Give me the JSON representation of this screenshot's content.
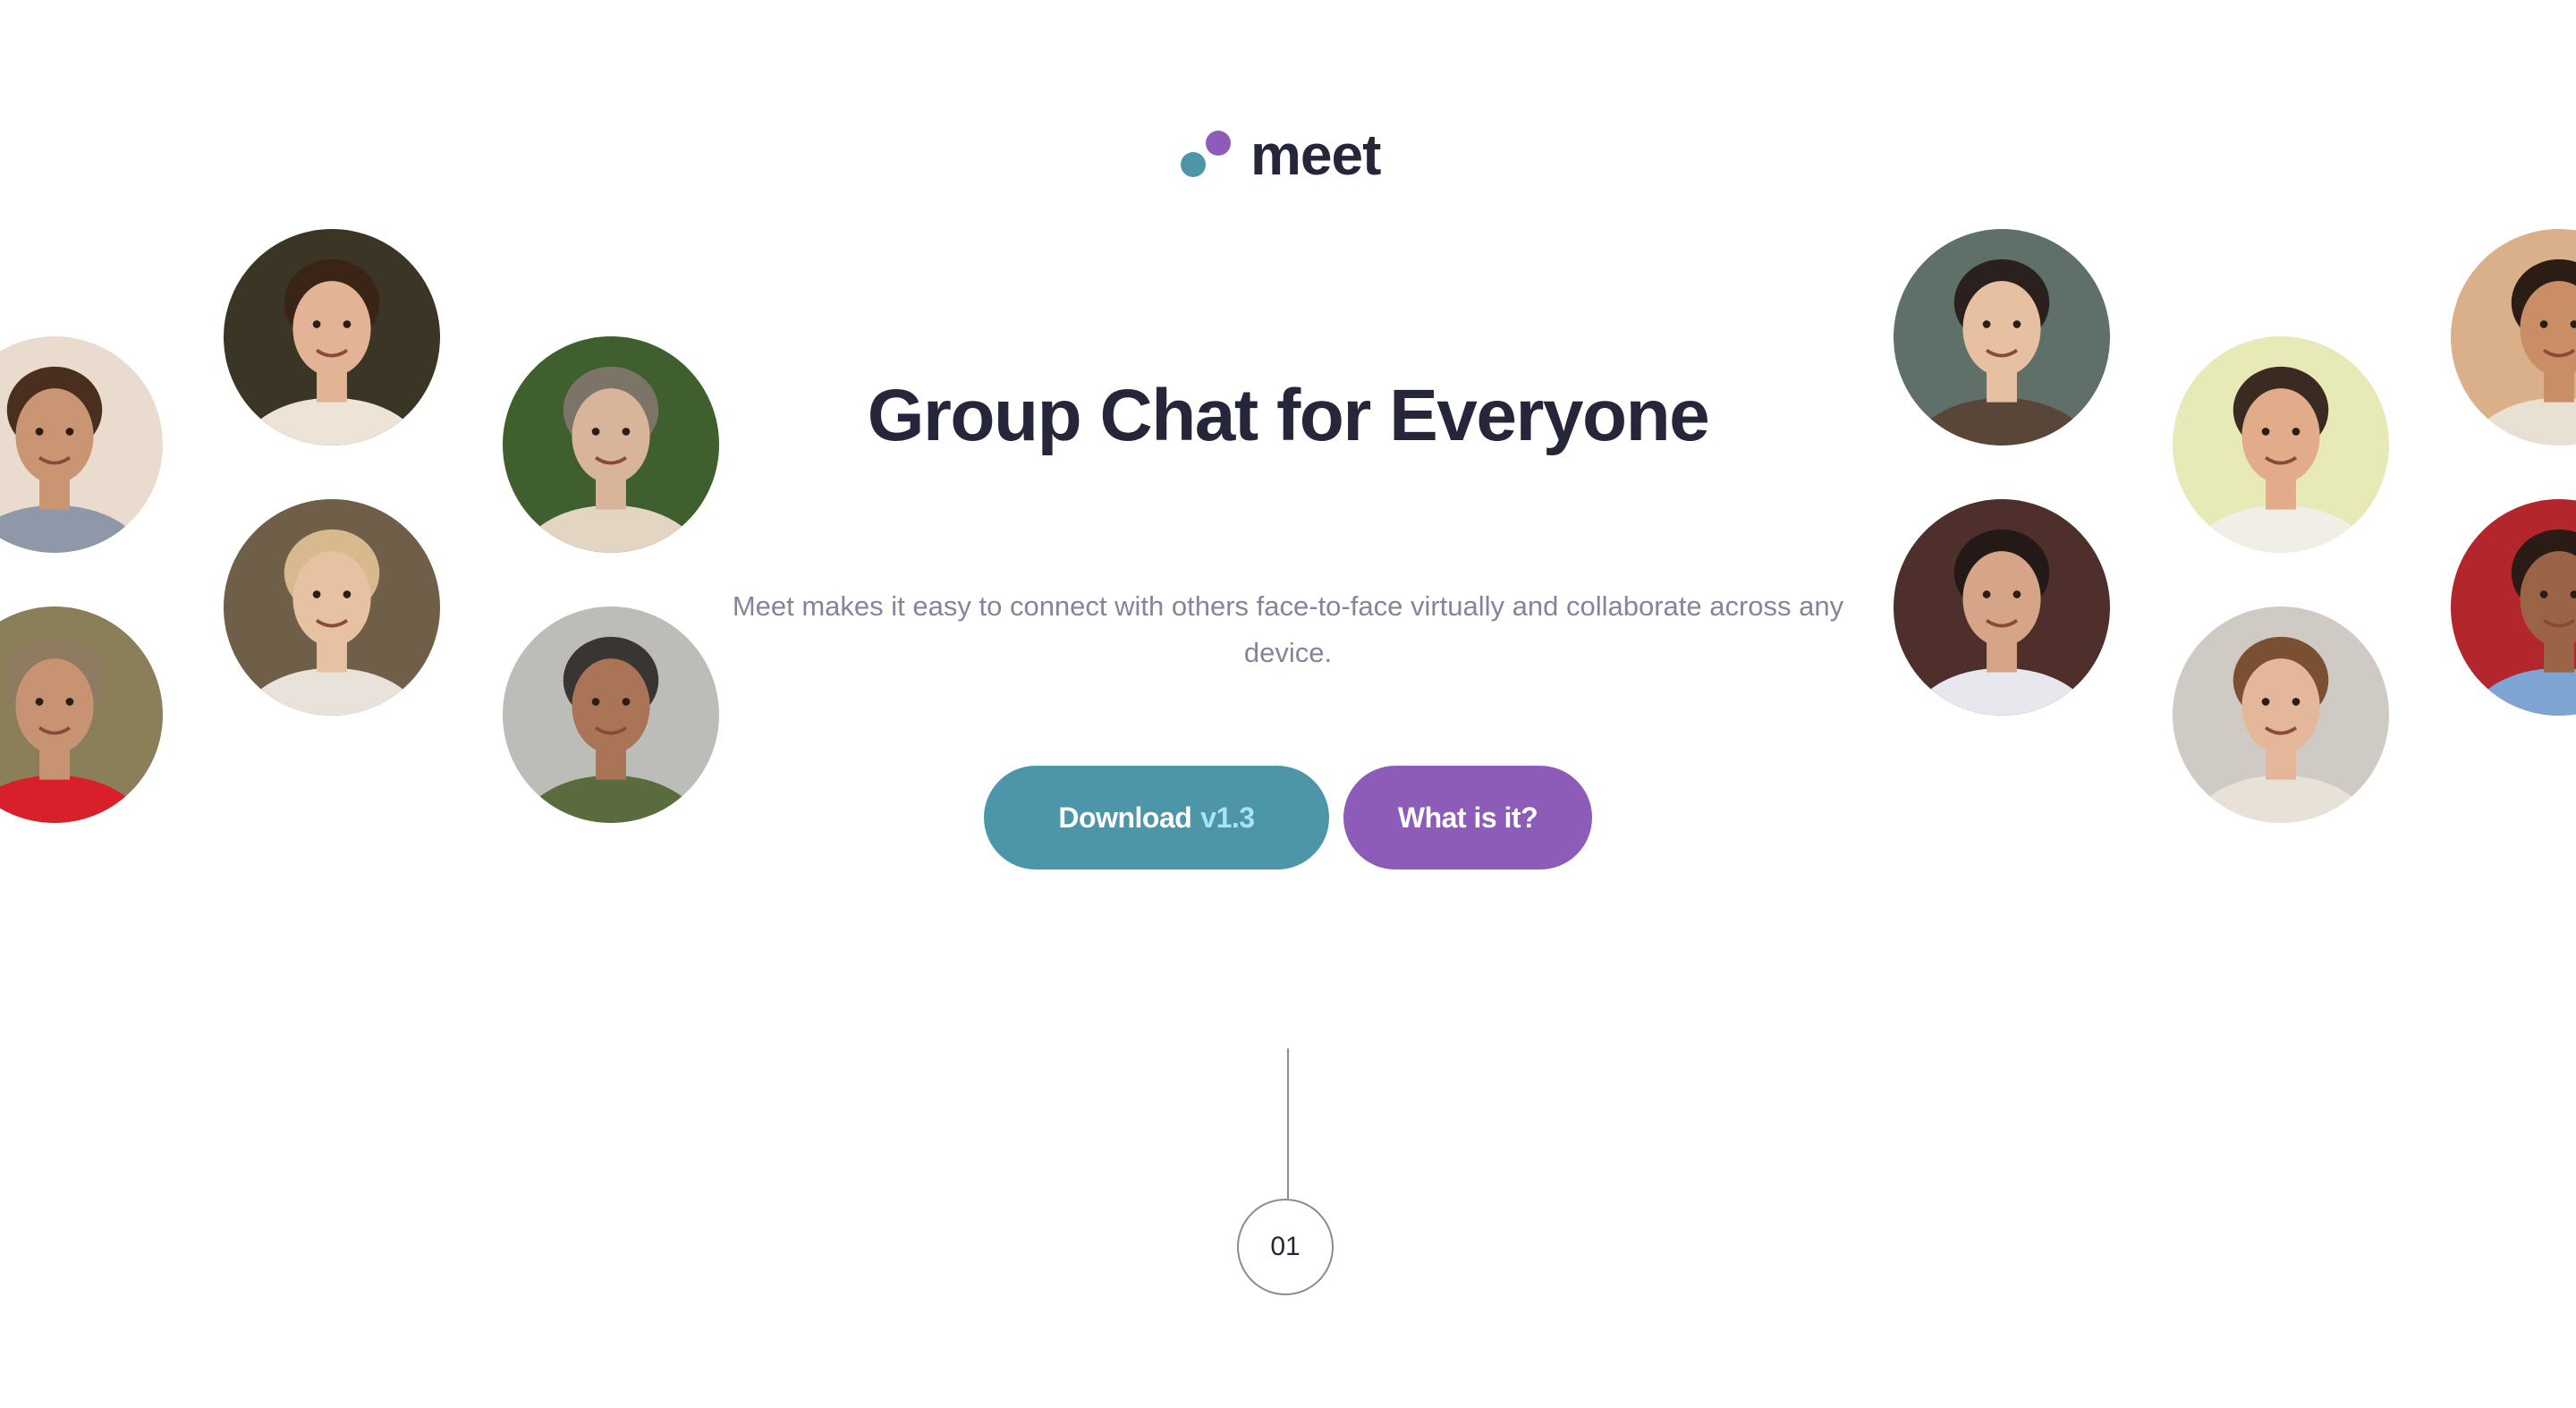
{
  "brand": {
    "name": "meet",
    "teal": "#4d96a9",
    "purple": "#8d5cb9",
    "dark": "#252639"
  },
  "hero": {
    "title": "Group Chat for Everyone",
    "description": "Meet makes it easy to connect with others face-to-face virtually and collaborate across any device."
  },
  "buttons": {
    "download_label": "Download",
    "download_version": "v1.3",
    "what_label": "What is it?"
  },
  "timeline": {
    "step": "01"
  },
  "avatars": [
    {
      "name": "avatar-young-man",
      "bg": "#e9dccf",
      "skin": "#c99572",
      "hair": "#4a2f1e",
      "shirt": "#8f98a8"
    },
    {
      "name": "avatar-woman-smiling",
      "bg": "#3b3526",
      "skin": "#e2b394",
      "hair": "#3a2416",
      "shirt": "#ede3d6"
    },
    {
      "name": "avatar-man-glasses",
      "bg": "#3f5f2e",
      "skin": "#d8b49a",
      "hair": "#7d7468",
      "shirt": "#e2d5c1"
    },
    {
      "name": "avatar-woman-blonde",
      "bg": "#6f5f49",
      "skin": "#e7c2a2",
      "hair": "#d6b98c",
      "shirt": "#e8e2da"
    },
    {
      "name": "avatar-man-fur-hat",
      "bg": "#8b7f5a",
      "skin": "#c79373",
      "hair": "#8f7a62",
      "shirt": "#d9202a"
    },
    {
      "name": "avatar-older-man",
      "bg": "#bcbcb8",
      "skin": "#a97556",
      "hair": "#3a3533",
      "shirt": "#5a6c3e"
    },
    {
      "name": "avatar-man-sunglasses",
      "bg": "#5e7068",
      "skin": "#e6c0a0",
      "hair": "#2a211e",
      "shirt": "#5a4638"
    },
    {
      "name": "avatar-man-laughing",
      "bg": "#e7e9b6",
      "skin": "#e2ac8a",
      "hair": "#3b2a21",
      "shirt": "#f1ede7"
    },
    {
      "name": "avatar-man-blossoms",
      "bg": "#4e2f2c",
      "skin": "#d6a486",
      "hair": "#231a17",
      "shirt": "#e6e8ee"
    },
    {
      "name": "avatar-man-curly-hair",
      "bg": "#cfcac4",
      "skin": "#e4b79a",
      "hair": "#7b4f31",
      "shirt": "#e7e1d8"
    },
    {
      "name": "avatar-man-flowers",
      "bg": "#d9b089",
      "skin": "#c98e66",
      "hair": "#2b1d15",
      "shirt": "#e8e0d2"
    },
    {
      "name": "avatar-woman-denim",
      "bg": "#b3262c",
      "skin": "#9c6447",
      "hair": "#2a1b15",
      "shirt": "#7ea4d3"
    }
  ]
}
